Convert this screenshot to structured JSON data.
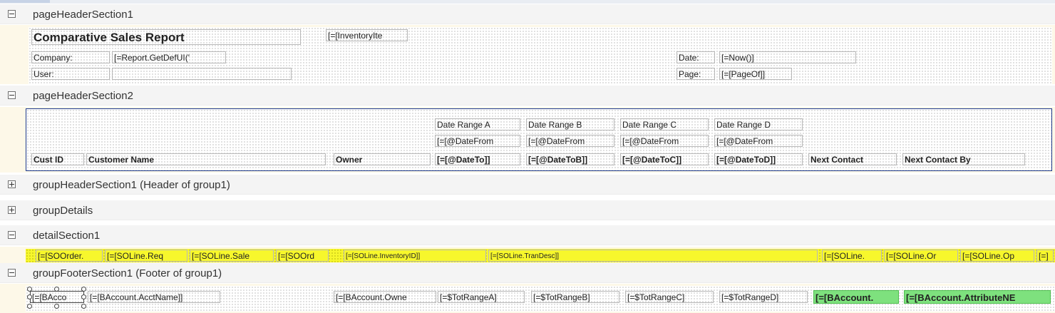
{
  "sections": {
    "page_header_1": {
      "label": "pageHeaderSection1",
      "expanded": true
    },
    "page_header_2": {
      "label": "pageHeaderSection2",
      "expanded": true
    },
    "group_header_1": {
      "label": "groupHeaderSection1 (Header of group1)",
      "expanded": false
    },
    "group_details": {
      "label": "groupDetails",
      "expanded": false
    },
    "detail_1": {
      "label": "detailSection1",
      "expanded": true
    },
    "group_footer_1": {
      "label": "groupFooterSection1 (Footer of group1)",
      "expanded": true
    }
  },
  "page_header_1": {
    "title": "Comparative Sales Report",
    "inventory_field": "[=[InventoryIte",
    "company_label": "Company:",
    "company_value": "[=Report.GetDefUI('",
    "user_label": "User:",
    "user_value": "",
    "date_label": "Date:",
    "date_value": "[=Now()]",
    "page_label": "Page:",
    "page_value": "[=[PageOf]]"
  },
  "page_header_2": {
    "range_a": "Date Range A",
    "range_b": "Date Range B",
    "range_c": "Date Range C",
    "range_d": "Date Range D",
    "from_a": "[=[@DateFrom",
    "from_b": "[=[@DateFrom",
    "from_c": "[=[@DateFrom",
    "from_d": "[=[@DateFrom",
    "cust_id": "Cust ID",
    "customer_name": "Customer Name",
    "owner": "Owner",
    "to_a": "[=[@DateTo]]",
    "to_b": "[=[@DateToB]]",
    "to_c": "[=[@DateToC]]",
    "to_d": "[=[@DateToD]]",
    "next_contact": "Next Contact",
    "next_contact_by": "Next Contact By"
  },
  "detail_1": {
    "f1": "[=[SOOrder.",
    "f2": "[=[SOLine.Req",
    "f3": "[=[SOLine.Sale",
    "f4": "[=[SOOrd",
    "f5": "[=[SOLine.InventoryID]]",
    "f6": "[=[SOLine.TranDesc]]",
    "f7": "[=[SOLine.",
    "f8": "[=[SOLine.Or",
    "f9": "[=[SOLine.Op",
    "f10": "[=]"
  },
  "group_footer_1": {
    "f1": "[=[BAcco",
    "f2": "[=[BAccount.AcctName]]",
    "f3": "[=[BAccount.Owne",
    "f4": "[=$TotRangeA]",
    "f5": "[=$TotRangeB]",
    "f6": "[=$TotRangeC]",
    "f7": "[=$TotRangeD]",
    "f8": "[=[BAccount.",
    "f9": "[=[BAccount.AttributeNE"
  },
  "colors": {
    "highlight_yellow": "#f7f72c",
    "highlight_green": "#7ee17e",
    "band_border": "#1f3b8c"
  }
}
